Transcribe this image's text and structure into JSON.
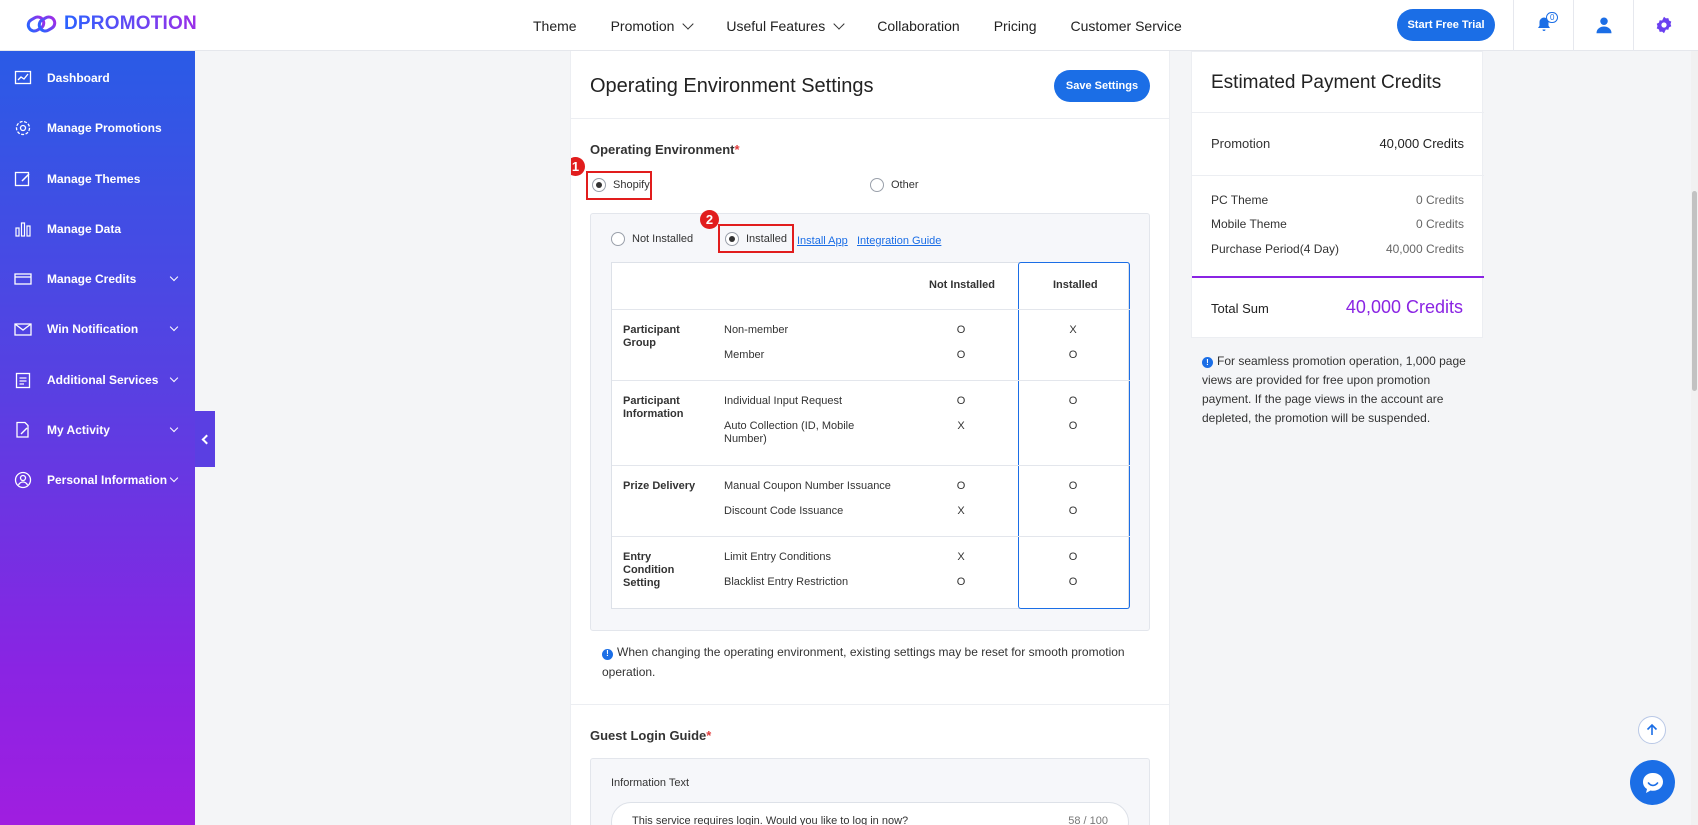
{
  "header": {
    "brand": "DPROMOTION",
    "nav": [
      {
        "label": "Theme",
        "has_dropdown": false
      },
      {
        "label": "Promotion",
        "has_dropdown": true
      },
      {
        "label": "Useful Features",
        "has_dropdown": true
      },
      {
        "label": "Collaboration",
        "has_dropdown": false
      },
      {
        "label": "Pricing",
        "has_dropdown": false
      },
      {
        "label": "Customer Service",
        "has_dropdown": false
      }
    ],
    "trial_button": "Start Free Trial",
    "notification_count": "0"
  },
  "sidebar": {
    "items": [
      {
        "label": "Dashboard",
        "icon": "chart-icon",
        "has_dropdown": false
      },
      {
        "label": "Manage Promotions",
        "icon": "gear-icon",
        "has_dropdown": false
      },
      {
        "label": "Manage Themes",
        "icon": "edit-icon",
        "has_dropdown": false
      },
      {
        "label": "Manage Data",
        "icon": "bar-chart-icon",
        "has_dropdown": false
      },
      {
        "label": "Manage Credits",
        "icon": "card-icon",
        "has_dropdown": true
      },
      {
        "label": "Win Notification",
        "icon": "mail-icon",
        "has_dropdown": true
      },
      {
        "label": "Additional Services",
        "icon": "clipboard-icon",
        "has_dropdown": true
      },
      {
        "label": "My Activity",
        "icon": "document-edit-icon",
        "has_dropdown": true
      },
      {
        "label": "Personal Information",
        "icon": "user-circle-icon",
        "has_dropdown": true
      }
    ]
  },
  "main": {
    "title": "Operating Environment Settings",
    "save_button": "Save Settings",
    "operating_environment": {
      "label": "Operating Environment",
      "required_mark": "*",
      "options": [
        {
          "label": "Shopify",
          "selected": true
        },
        {
          "label": "Other",
          "selected": false
        }
      ],
      "marker_1": "1",
      "marker_2": "2",
      "install_options": [
        {
          "label": "Not Installed",
          "selected": false
        },
        {
          "label": "Installed",
          "selected": true
        }
      ],
      "install_app_link": "Install App",
      "integration_guide_link": "Integration Guide",
      "table": {
        "headers": [
          "Not Installed",
          "Installed"
        ],
        "groups": [
          {
            "group": "Participant Group",
            "rows": [
              {
                "feature": "Non-member",
                "not_installed": "O",
                "installed": "X"
              },
              {
                "feature": "Member",
                "not_installed": "O",
                "installed": "O"
              }
            ]
          },
          {
            "group": "Participant Information",
            "rows": [
              {
                "feature": "Individual Input Request",
                "not_installed": "O",
                "installed": "O"
              },
              {
                "feature": "Auto Collection (ID, Mobile Number)",
                "not_installed": "X",
                "installed": "O"
              }
            ]
          },
          {
            "group": "Prize Delivery",
            "rows": [
              {
                "feature": "Manual Coupon Number Issuance",
                "not_installed": "O",
                "installed": "O"
              },
              {
                "feature": "Discount Code Issuance",
                "not_installed": "X",
                "installed": "O"
              }
            ]
          },
          {
            "group": "Entry Condition Setting",
            "rows": [
              {
                "feature": "Limit Entry Conditions",
                "not_installed": "X",
                "installed": "O"
              },
              {
                "feature": "Blacklist Entry Restriction",
                "not_installed": "O",
                "installed": "O"
              }
            ]
          }
        ]
      },
      "note": "When changing the operating environment, existing settings may be reset for smooth promotion operation."
    },
    "guest_login": {
      "label": "Guest Login Guide",
      "required_mark": "*",
      "info_label": "Information Text",
      "value": "This service requires login. Would you like to log in now?",
      "counter": "58 / 100"
    }
  },
  "payment": {
    "title": "Estimated Payment Credits",
    "promotion_label": "Promotion",
    "promotion_value": "40,000 Credits",
    "rows": [
      {
        "label": "PC Theme",
        "value": "0 Credits"
      },
      {
        "label": "Mobile Theme",
        "value": "0 Credits"
      },
      {
        "label": "Purchase Period(4 Day)",
        "value": "40,000 Credits"
      }
    ],
    "total_label": "Total Sum",
    "total_value": "40,000 Credits",
    "note": "For seamless promotion operation, 1,000 page views are provided for free upon promotion payment. If the page views in the account are depleted, the promotion will be suspended."
  },
  "colors": {
    "accent": "#1b6ee6",
    "purple": "#8a24e3",
    "highlight": "#e11d1d"
  }
}
